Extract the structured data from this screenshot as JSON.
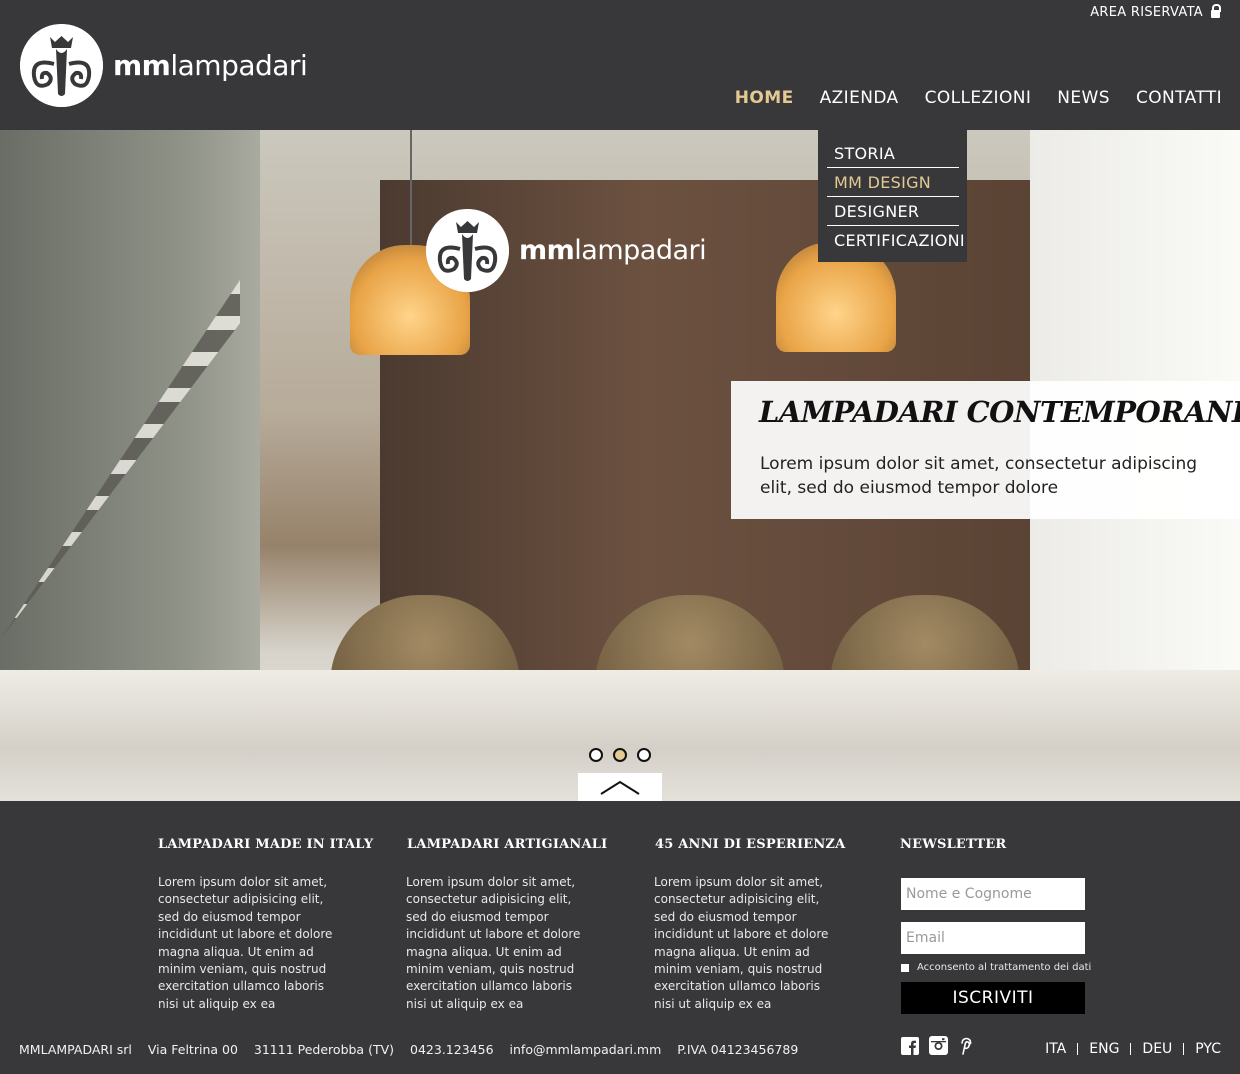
{
  "header": {
    "area_riservata": "AREA RISERVATA",
    "logo_text_bold": "mm",
    "logo_text": "lampadari"
  },
  "nav": {
    "items": [
      {
        "label": "HOME",
        "active": true
      },
      {
        "label": "AZIENDA",
        "active": false
      },
      {
        "label": "COLLEZIONI",
        "active": false
      },
      {
        "label": "NEWS",
        "active": false
      },
      {
        "label": "CONTATTI",
        "active": false
      }
    ]
  },
  "submenu": {
    "items": [
      {
        "label": "STORIA"
      },
      {
        "label": "MM DESIGN",
        "active": true
      },
      {
        "label": "DESIGNER"
      },
      {
        "label": "CERTIFICAZIONI"
      }
    ]
  },
  "slider": {
    "logo_text_bold": "mm",
    "logo_text": "lampadari",
    "title": "LAMPADARI CONTEMPORANEI",
    "text": "Lorem ipsum dolor sit amet, consectetur adipiscing elit, sed do eiusmod tempor dolore",
    "slide_count": 3,
    "active_slide": 2
  },
  "columns": [
    {
      "title": "LAMPADARI MADE IN ITALY",
      "text": "Lorem ipsum dolor sit amet, consectetur adipisicing elit, sed do eiusmod tempor incididunt ut labore et dolore magna aliqua. Ut enim ad minim veniam, quis nostrud exercitation ullamco laboris nisi ut aliquip ex ea"
    },
    {
      "title": "LAMPADARI ARTIGIANALI",
      "text": "Lorem ipsum dolor sit amet, consectetur adipisicing elit, sed do eiusmod tempor incididunt ut labore et dolore magna aliqua. Ut enim ad minim veniam, quis nostrud exercitation ullamco laboris nisi ut aliquip ex ea"
    },
    {
      "title": "45 ANNI DI ESPERIENZA",
      "text": "Lorem ipsum dolor sit amet, consectetur adipisicing elit, sed do eiusmod tempor incididunt ut labore et dolore magna aliqua. Ut enim ad minim veniam, quis nostrud exercitation ullamco laboris nisi ut aliquip ex ea"
    }
  ],
  "newsletter": {
    "title": "NEWSLETTER",
    "name_placeholder": "Nome e Cognome",
    "email_placeholder": "Email",
    "consent": "Acconsento al trattamento dei dati",
    "submit": "ISCRIVITI"
  },
  "footer": {
    "company": "MMLAMPADARI srl",
    "address": "Via Feltrina 00",
    "city": "31111 Pederobba  (TV)",
    "phone": "0423.123456",
    "email": "info@mmlampadari.mm",
    "vat": "P.IVA 04123456789",
    "social": [
      "facebook-icon",
      "instagram-icon",
      "pinterest-icon"
    ],
    "languages": [
      "ITA",
      "ENG",
      "DEU",
      "PYC"
    ]
  },
  "colors": {
    "background": "#38383b",
    "accent": "#e4c992"
  }
}
